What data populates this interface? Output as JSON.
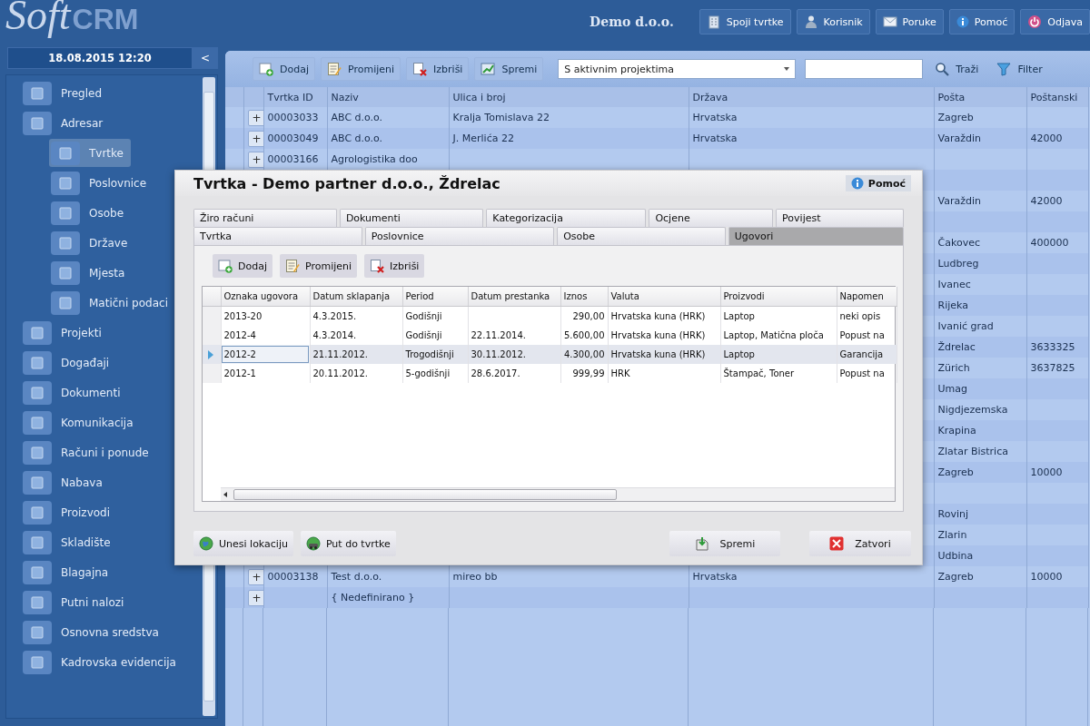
{
  "header": {
    "logo_light": "Soft",
    "logo_bold": "CRM",
    "company": "Demo d.o.o.",
    "buttons": [
      {
        "label": "Spoji tvrtke",
        "kind": "merge"
      },
      {
        "label": "Korisnik",
        "kind": "user"
      },
      {
        "label": "Poruke",
        "kind": "messages"
      },
      {
        "label": "Pomoć",
        "kind": "help"
      },
      {
        "label": "Odjava",
        "kind": "logout"
      }
    ]
  },
  "sidebar": {
    "datetime": "18.08.2015 12:20",
    "collapse": "<",
    "items": [
      {
        "label": "Pregled",
        "selected": false
      },
      {
        "label": "Adresar",
        "selected": false,
        "children": [
          {
            "label": "Tvrtke",
            "selected": true
          },
          {
            "label": "Poslovnice",
            "selected": false
          },
          {
            "label": "Osobe",
            "selected": false
          },
          {
            "label": "Države",
            "selected": false
          },
          {
            "label": "Mjesta",
            "selected": false
          },
          {
            "label": "Matični podaci",
            "selected": false
          }
        ]
      },
      {
        "label": "Projekti",
        "selected": false
      },
      {
        "label": "Događaji",
        "selected": false
      },
      {
        "label": "Dokumenti",
        "selected": false
      },
      {
        "label": "Komunikacija",
        "selected": false
      },
      {
        "label": "Računi i ponude",
        "selected": false
      },
      {
        "label": "Nabava",
        "selected": false
      },
      {
        "label": "Proizvodi",
        "selected": false
      },
      {
        "label": "Skladište",
        "selected": false
      },
      {
        "label": "Blagajna",
        "selected": false
      },
      {
        "label": "Putni nalozi",
        "selected": false
      },
      {
        "label": "Osnovna sredstva",
        "selected": false
      },
      {
        "label": "Kadrovska evidencija",
        "selected": false
      }
    ]
  },
  "toolbar": {
    "buttons": [
      {
        "label": "Dodaj",
        "kind": "add"
      },
      {
        "label": "Promijeni",
        "kind": "edit"
      },
      {
        "label": "Izbriši",
        "kind": "delete"
      },
      {
        "label": "Spremi",
        "kind": "export"
      }
    ],
    "filter_select": "S aktivnim projektima",
    "search_button": "Traži",
    "filter_button": "Filter"
  },
  "table": {
    "columns": [
      "Tvrtka ID",
      "Naziv",
      "Ulica i broj",
      "Država",
      "Pošta",
      "Poštanski"
    ],
    "rows": [
      {
        "plus": "+",
        "cells": [
          "00003033",
          "ABC d.o.o.",
          "Kralja Tomislava 22",
          "Hrvatska",
          "Zagreb",
          null
        ]
      },
      {
        "plus": "+",
        "cells": [
          "00003049",
          "ABC d.o.o.",
          "J. Merlića 22",
          "Hrvatska",
          "Varaždin",
          "42000"
        ]
      },
      {
        "plus": "+",
        "cells": [
          "00003166",
          "Agrologistika doo",
          null,
          null,
          null,
          null
        ]
      },
      {
        "cells": [
          null,
          null,
          null,
          null,
          null,
          null
        ]
      },
      {
        "cells": [
          null,
          null,
          null,
          null,
          "Varaždin",
          "42000"
        ]
      },
      {
        "cells": [
          null,
          null,
          null,
          null,
          null,
          null
        ]
      },
      {
        "cells": [
          null,
          null,
          null,
          null,
          "Čakovec",
          "400000"
        ]
      },
      {
        "cells": [
          null,
          null,
          null,
          null,
          "Ludbreg",
          null
        ]
      },
      {
        "cells": [
          null,
          null,
          null,
          null,
          "Ivanec",
          null
        ]
      },
      {
        "cells": [
          null,
          null,
          null,
          null,
          "Rijeka",
          null
        ]
      },
      {
        "cells": [
          null,
          null,
          null,
          null,
          "Ivanić grad",
          null
        ]
      },
      {
        "cells": [
          null,
          null,
          null,
          null,
          "Ždrelac",
          "3633325"
        ]
      },
      {
        "cells": [
          null,
          null,
          null,
          null,
          "Zürich",
          "3637825"
        ]
      },
      {
        "cells": [
          null,
          null,
          null,
          null,
          "Umag",
          null
        ]
      },
      {
        "cells": [
          null,
          null,
          null,
          null,
          "Nigdjezemska",
          null
        ]
      },
      {
        "cells": [
          null,
          null,
          null,
          null,
          "Krapina",
          null
        ]
      },
      {
        "cells": [
          null,
          null,
          null,
          null,
          "Zlatar Bistrica",
          null
        ]
      },
      {
        "cells": [
          null,
          null,
          null,
          null,
          "Zagreb",
          "10000"
        ]
      },
      {
        "cells": [
          null,
          null,
          null,
          null,
          null,
          null
        ]
      },
      {
        "cells": [
          null,
          null,
          null,
          null,
          "Rovinj",
          null
        ]
      },
      {
        "cells": [
          null,
          null,
          null,
          null,
          "Zlarin",
          null
        ]
      },
      {
        "cells": [
          null,
          null,
          null,
          null,
          "Udbina",
          null
        ]
      },
      {
        "plus": "+",
        "cells": [
          "00003138",
          "Test d.o.o.",
          "mireo bb",
          "Hrvatska",
          "Zagreb",
          "10000"
        ]
      },
      {
        "plus": "+",
        "cells": [
          null,
          "{ Nedefinirano }",
          null,
          null,
          null,
          null
        ]
      }
    ]
  },
  "dialog": {
    "title": "Tvrtka - Demo partner d.o.o., Ždrelac",
    "help": "Pomoć",
    "tabs": [
      [
        {
          "label": "Žiro računi",
          "selected": false
        },
        {
          "label": "Dokumenti",
          "selected": false
        },
        {
          "label": "Kategorizacija",
          "selected": false
        },
        {
          "label": "Ocjene",
          "selected": false
        },
        {
          "label": "Povijest",
          "selected": false
        }
      ],
      [
        {
          "label": "Tvrtka",
          "selected": false
        },
        {
          "label": "Poslovnice",
          "selected": false
        },
        {
          "label": "Osobe",
          "selected": false
        },
        {
          "label": "Ugovori",
          "selected": true
        }
      ]
    ],
    "buttons": [
      {
        "label": "Dodaj",
        "kind": "add"
      },
      {
        "label": "Promijeni",
        "kind": "edit"
      },
      {
        "label": "Izbriši",
        "kind": "delete"
      }
    ],
    "grid": {
      "columns": [
        "Oznaka ugovora",
        "Datum sklapanja",
        "Period",
        "Datum prestanka",
        "Iznos",
        "Valuta",
        "Proizvodi",
        "Napomen"
      ],
      "rows": [
        {
          "selected": false,
          "cells": [
            "2013-20",
            "4.3.2015.",
            "Godišnji",
            null,
            "290,00",
            "Hrvatska kuna (HRK)",
            "Laptop",
            "neki opis"
          ]
        },
        {
          "selected": false,
          "cells": [
            "2012-4",
            "4.3.2014.",
            "Godišnji",
            "22.11.2014.",
            "5.600,00",
            "Hrvatska kuna (HRK)",
            "Laptop, Matična ploča",
            "Popust na"
          ]
        },
        {
          "selected": true,
          "cells": [
            "2012-2",
            "21.11.2012.",
            "Trogodišnji",
            "30.11.2012.",
            "4.300,00",
            "Hrvatska kuna (HRK)",
            "Laptop",
            "Garancija"
          ]
        },
        {
          "selected": false,
          "cells": [
            "2012-1",
            "20.11.2012.",
            "5-godišnji",
            "28.6.2017.",
            "999,99",
            "HRK",
            "Štampač, Toner",
            "Popust na"
          ]
        }
      ]
    },
    "footer_left": [
      {
        "label": "Unesi lokaciju",
        "kind": "location"
      },
      {
        "label": "Put do tvrtke",
        "kind": "route"
      }
    ],
    "footer_right": [
      {
        "label": "Spremi",
        "kind": "save"
      },
      {
        "label": "Zatvori",
        "kind": "close"
      }
    ]
  }
}
